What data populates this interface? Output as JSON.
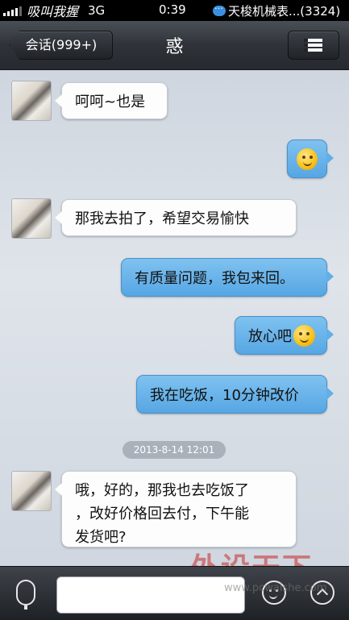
{
  "status_bar": {
    "carrier": "吸叫我握",
    "network": "3G",
    "time": "0:39",
    "notification": "天梭机械表...(3324)"
  },
  "nav": {
    "back_label": "会话(999+)",
    "title": "惑",
    "menu_icon": "list-icon"
  },
  "messages": [
    {
      "side": "in",
      "text": "呵呵~也是"
    },
    {
      "side": "out",
      "text": "",
      "emoji": "smile"
    },
    {
      "side": "in",
      "text": "那我去拍了，希望交易愉快"
    },
    {
      "side": "out",
      "text": "有质量问题，我包来回。"
    },
    {
      "side": "out",
      "text": "放心吧",
      "emoji": "smile"
    },
    {
      "side": "out",
      "text": "我在吃饭，10分钟改价"
    },
    {
      "side": "in",
      "lines": [
        "哦，好的，那我也去吃饭了",
        "，改好价格回去付，下午能",
        "发货吧?"
      ]
    }
  ],
  "timestamp": "2013-8-14  12:01",
  "input": {
    "value": ""
  },
  "watermark": {
    "text": "外设天下",
    "url": "www.pcwaishe.com"
  },
  "colors": {
    "out_bubble": "#62aee8",
    "in_bubble": "#fdfdfd",
    "nav_bar": "#2f3339"
  }
}
